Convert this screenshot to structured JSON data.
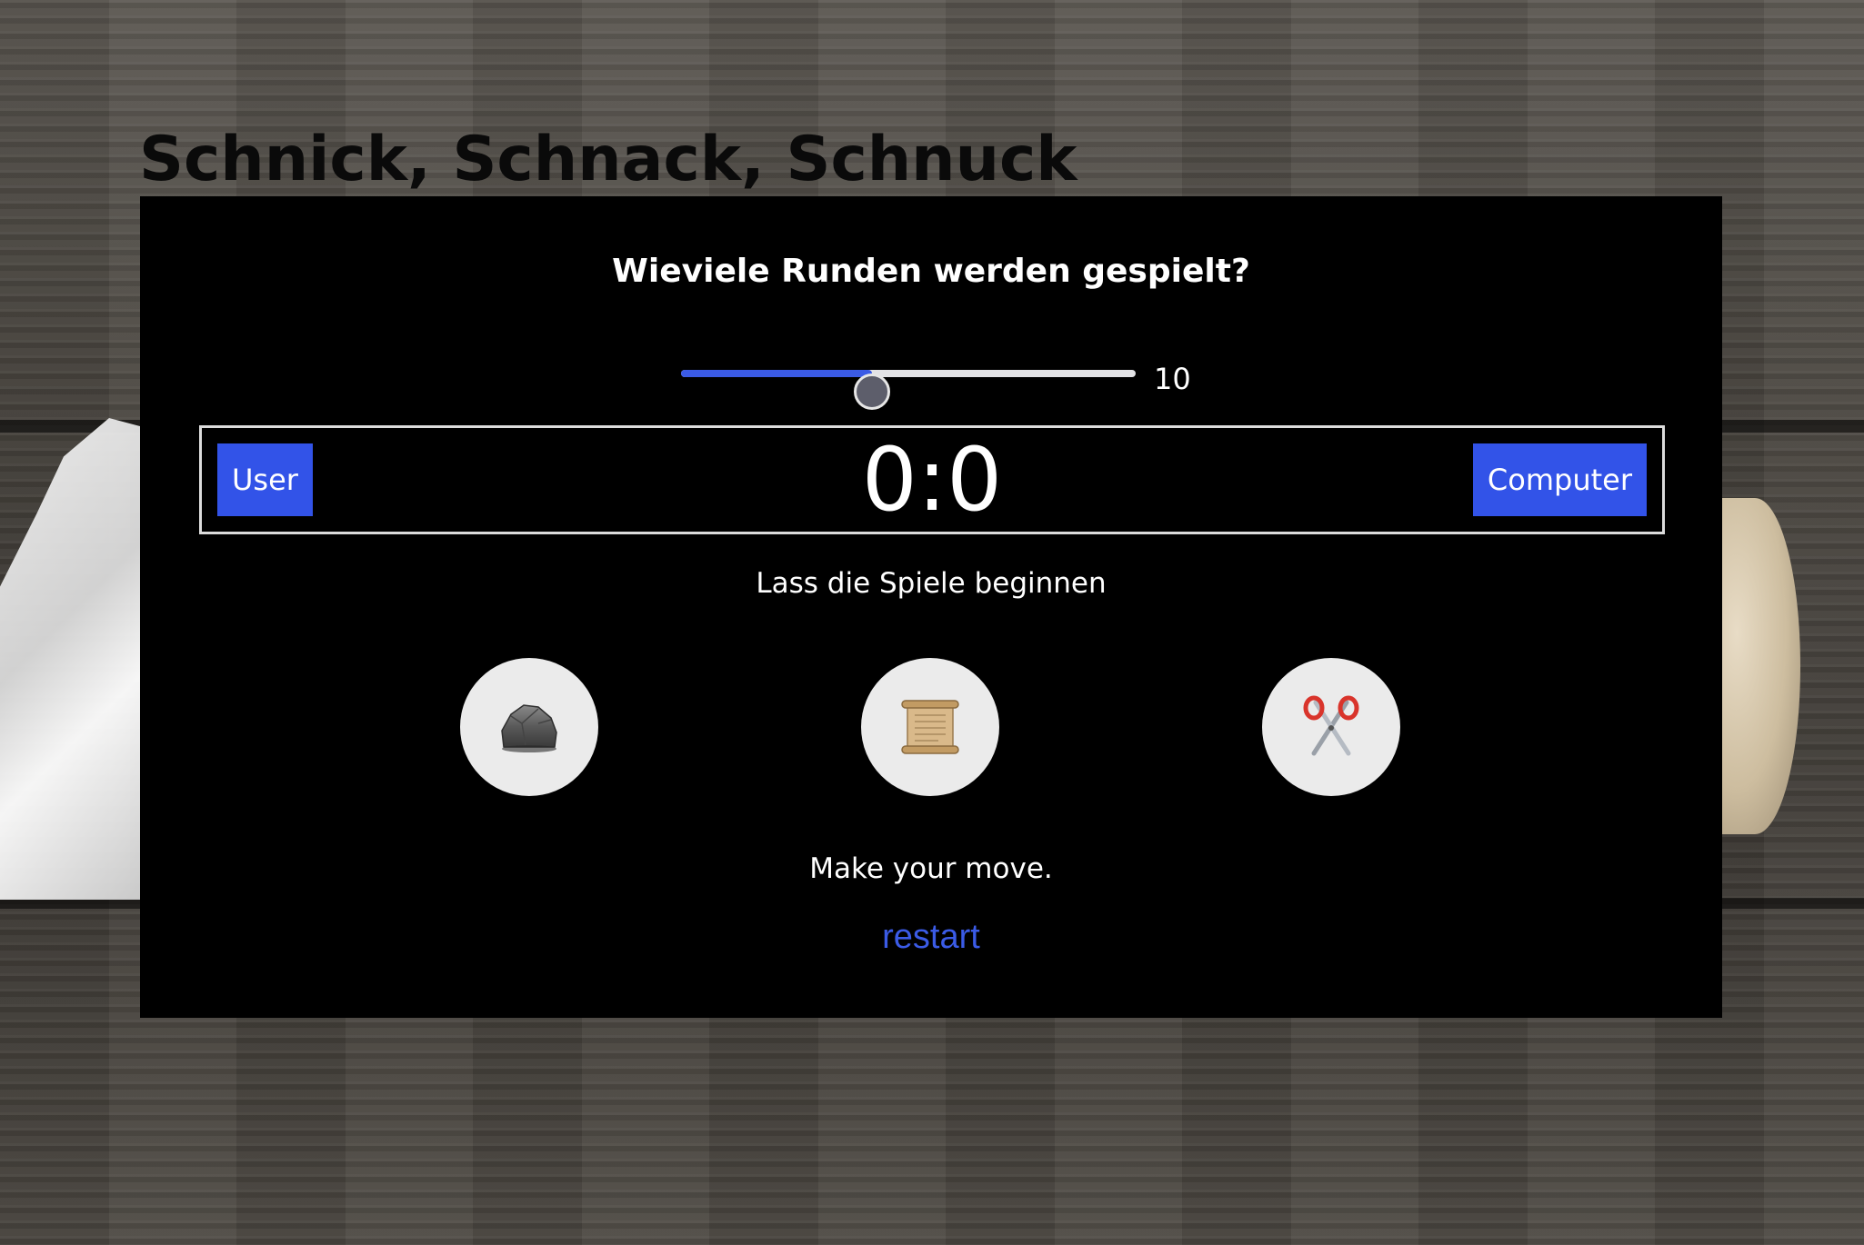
{
  "page": {
    "title": "Schnick, Schnack, Schnuck"
  },
  "rounds": {
    "question": "Wieviele Runden werden gespielt?",
    "value": "10",
    "min": 1,
    "max": 20,
    "fraction": 0.42
  },
  "scoreboard": {
    "user_label": "User",
    "computer_label": "Computer",
    "score": "0:0"
  },
  "status": {
    "message": "Lass die Spiele beginnen",
    "prompt": "Make your move."
  },
  "choices": [
    {
      "id": "rock",
      "icon": "rock-icon"
    },
    {
      "id": "paper",
      "icon": "scroll-icon"
    },
    {
      "id": "scissors",
      "icon": "scissors-icon"
    }
  ],
  "actions": {
    "restart_label": "restart"
  },
  "colors": {
    "accent": "#3253e8",
    "panel": "#000000",
    "choice_bg": "#ebebeb"
  }
}
